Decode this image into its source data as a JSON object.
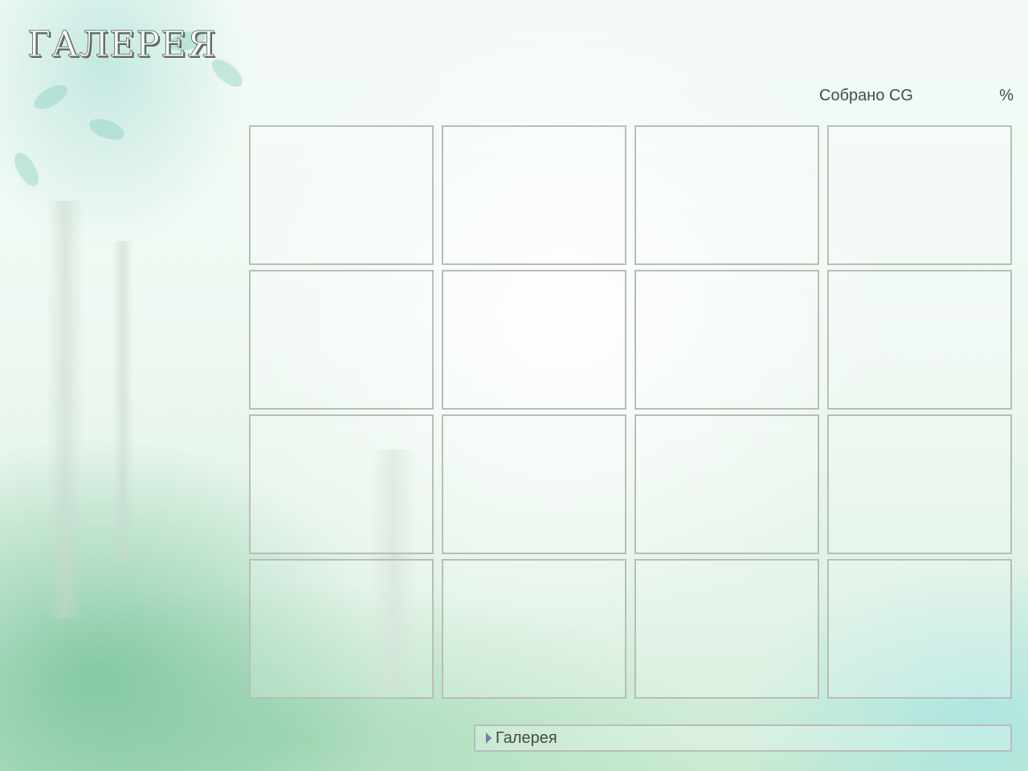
{
  "screen": {
    "title": "ГАЛЕРЕЯ"
  },
  "collection": {
    "label": "Собрано CG",
    "value": "",
    "percent_sign": "%"
  },
  "gallery": {
    "rows": 4,
    "columns": 4,
    "slots": [
      {
        "row": 1,
        "col": 1,
        "state": "empty"
      },
      {
        "row": 1,
        "col": 2,
        "state": "empty"
      },
      {
        "row": 1,
        "col": 3,
        "state": "empty"
      },
      {
        "row": 1,
        "col": 4,
        "state": "empty"
      },
      {
        "row": 2,
        "col": 1,
        "state": "empty"
      },
      {
        "row": 2,
        "col": 2,
        "state": "empty"
      },
      {
        "row": 2,
        "col": 3,
        "state": "empty"
      },
      {
        "row": 2,
        "col": 4,
        "state": "empty"
      },
      {
        "row": 3,
        "col": 1,
        "state": "empty"
      },
      {
        "row": 3,
        "col": 2,
        "state": "empty"
      },
      {
        "row": 3,
        "col": 3,
        "state": "empty"
      },
      {
        "row": 3,
        "col": 4,
        "state": "empty"
      },
      {
        "row": 4,
        "col": 1,
        "state": "empty"
      },
      {
        "row": 4,
        "col": 2,
        "state": "empty"
      },
      {
        "row": 4,
        "col": 3,
        "state": "empty"
      },
      {
        "row": 4,
        "col": 4,
        "state": "empty"
      }
    ]
  },
  "status_bar": {
    "icon": "triangle-right-icon",
    "text": "Галерея"
  },
  "colors": {
    "frame_border": "#b8bdb9",
    "text": "#444a46",
    "arrow": "#7480a0"
  }
}
